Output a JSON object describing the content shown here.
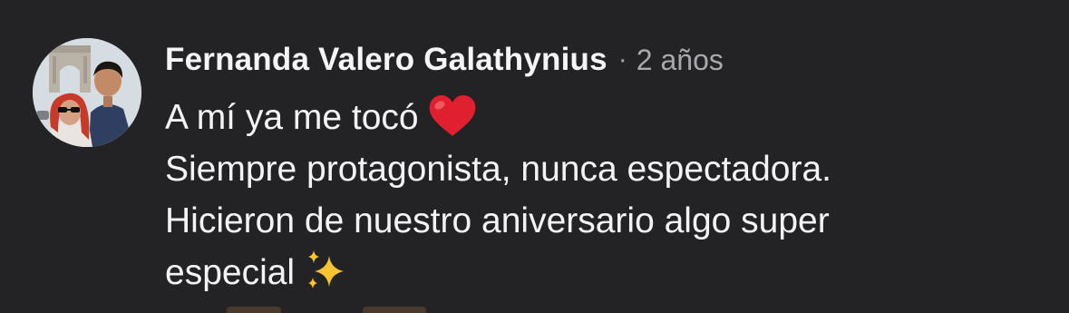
{
  "comment": {
    "author": "Fernanda Valero Galathynius",
    "separator": "·",
    "timestamp": "2 años",
    "lines": [
      "A mí ya me tocó",
      "Siempre protagonista, nunca espectadora.",
      "Hicieron de nuestro aniversario algo super",
      "especial"
    ],
    "avatar_icon": "profile-photo-couple",
    "emoji_1": "red-heart-emoji",
    "emoji_2": "sparkles-emoji"
  },
  "colors": {
    "background": "#232325",
    "text": "#f3f3f5",
    "muted_text": "#a9a9ad",
    "heart": "#e0202e",
    "sparkle": "#f6c531"
  }
}
